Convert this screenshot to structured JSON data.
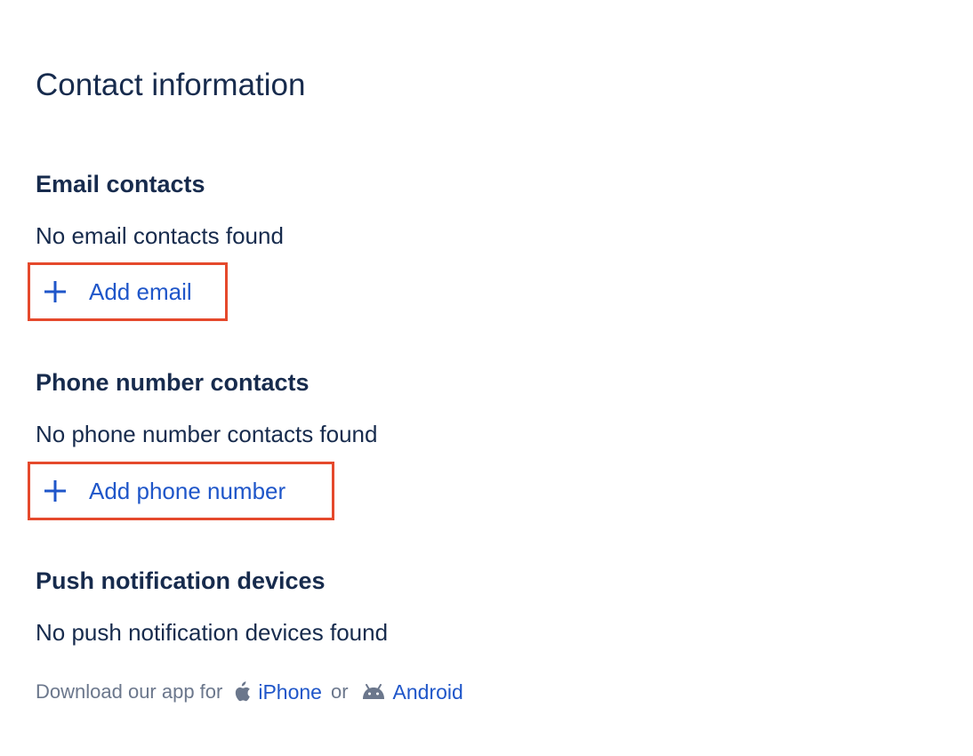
{
  "page": {
    "title": "Contact information"
  },
  "email_section": {
    "heading": "Email contacts",
    "empty_text": "No email contacts found",
    "add_label": "Add email"
  },
  "phone_section": {
    "heading": "Phone number contacts",
    "empty_text": "No phone number contacts found",
    "add_label": "Add phone number"
  },
  "push_section": {
    "heading": "Push notification devices",
    "empty_text": "No push notification devices found",
    "download_prefix": "Download our app for",
    "iphone_label": "iPhone",
    "or_text": "or",
    "android_label": "Android"
  },
  "icons": {
    "add": "plus-icon",
    "iphone": "apple-icon",
    "android": "android-icon"
  },
  "colors": {
    "text": "#172b4d",
    "link": "#1f56c9",
    "muted": "#6b778c",
    "highlight_border": "#e5492c"
  }
}
